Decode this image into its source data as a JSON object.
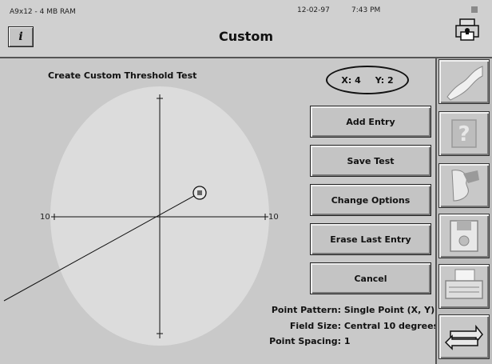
{
  "header": {
    "device": "A9x12 - 4 MB RAM",
    "date": "12-02-97",
    "time": "7:43 PM",
    "title": "Custom",
    "info_label": "i"
  },
  "test": {
    "title": "Create Custom Threshold Test",
    "x_label": "X: 4",
    "y_label": "Y: 2",
    "axis_left": "10",
    "axis_right": "10"
  },
  "buttons": {
    "add_entry": "Add Entry",
    "save_test": "Save Test",
    "change_options": "Change Options",
    "erase_last": "Erase Last Entry",
    "cancel": "Cancel"
  },
  "settings": {
    "pattern_label": "Point Pattern:",
    "pattern_value": "Single Point (X, Y)",
    "field_label": "Field Size:",
    "field_value": "Central 10 degrees",
    "spacing_label": "Point Spacing:",
    "spacing_value": "1"
  },
  "colors": {
    "field": "#dcdcdc",
    "panel": "#c9c9c9"
  },
  "toolbar_icons": [
    "curve-icon",
    "help-icon",
    "patient-icon",
    "disk-icon",
    "printer-icon",
    "return-icon"
  ]
}
